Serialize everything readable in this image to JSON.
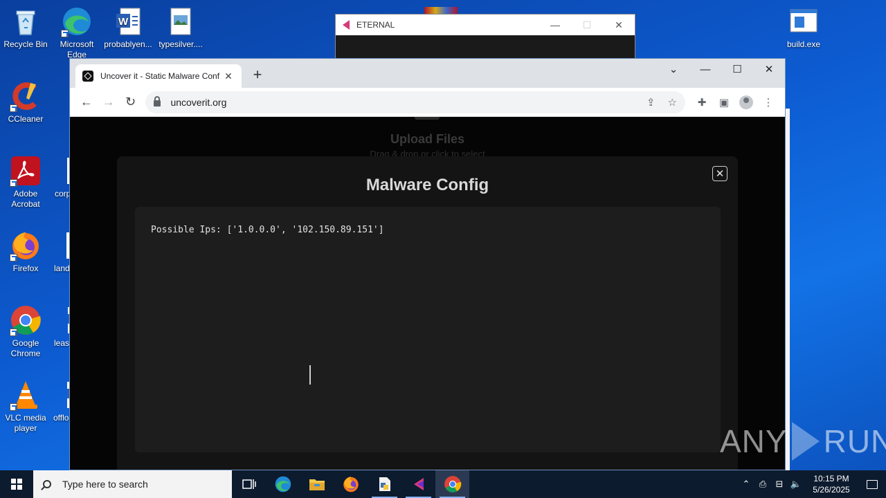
{
  "desktop": {
    "icons": [
      {
        "label": "Recycle Bin"
      },
      {
        "label": "Microsoft Edge"
      },
      {
        "label": "probablyen..."
      },
      {
        "label": "typesilver...."
      },
      {
        "label": "build.exe"
      },
      {
        "label": "CCleaner"
      },
      {
        "label": "Adobe Acrobat"
      },
      {
        "label": "corp"
      },
      {
        "label": "Firefox"
      },
      {
        "label": "land"
      },
      {
        "label": "Google Chrome"
      },
      {
        "label": "leas"
      },
      {
        "label": "VLC media player"
      },
      {
        "label": "offlo"
      }
    ]
  },
  "eternal_window": {
    "title": "ETERNAL"
  },
  "browser": {
    "tab_title": "Uncover it - Static Malware Conf",
    "url": "uncoverit.org",
    "controls": {
      "minimize": "—",
      "maximize": "☐",
      "close": "✕",
      "tab_menu": "⌄"
    }
  },
  "page": {
    "upload_title": "Upload Files",
    "upload_subtitle": "Drag & drop or click to select",
    "modal": {
      "title": "Malware Config",
      "close_symbol": "✕",
      "config_text": "Possible Ips: ['1.0.0.0', '102.150.89.151']"
    }
  },
  "watermark": {
    "left": "ANY",
    "right": "RUN"
  },
  "taskbar": {
    "search_placeholder": "Type here to search",
    "time": "10:15 PM",
    "date": "5/26/2025"
  },
  "colors": {
    "desktop_bg": "#0d5bd1",
    "modal_bg": "#141414",
    "config_bg": "#1d1d1d",
    "taskbar_bg": "#0d1b2e"
  }
}
